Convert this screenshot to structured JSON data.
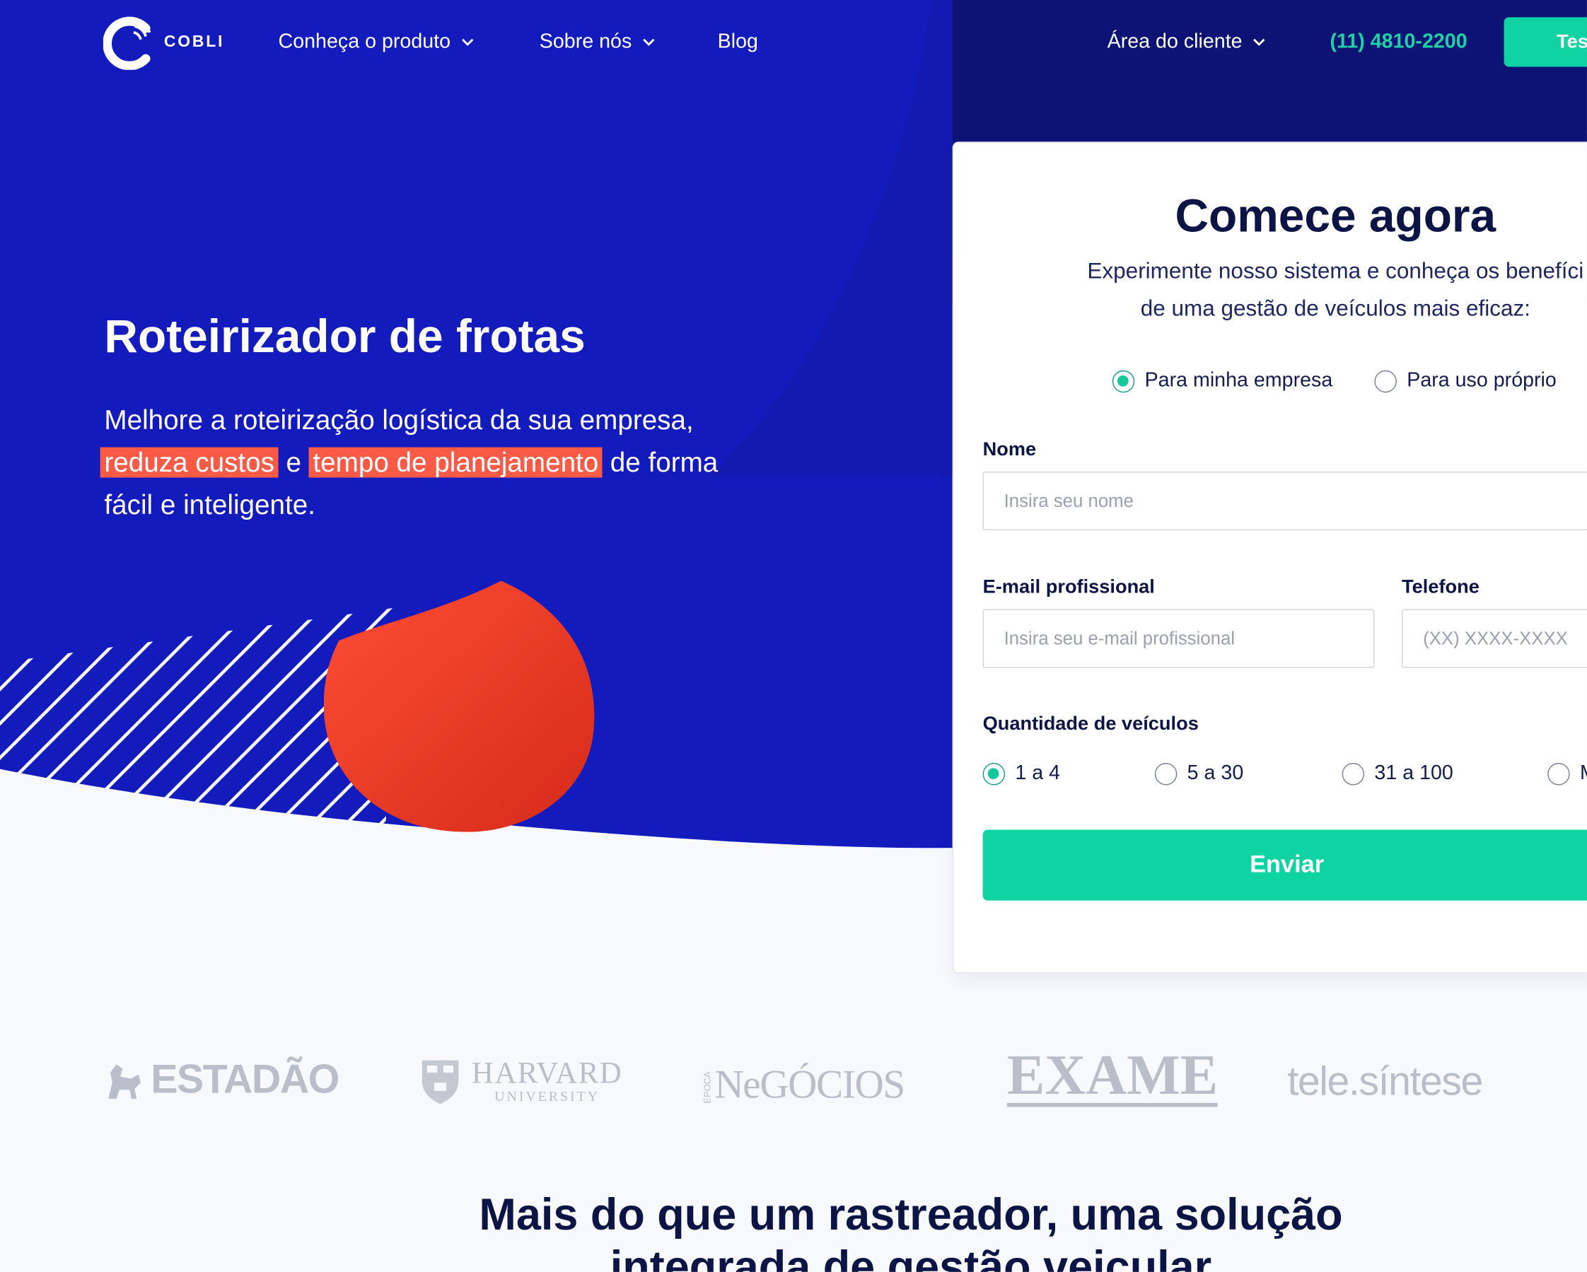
{
  "nav": {
    "brand": "COBLI",
    "product": "Conheça o produto",
    "about": "Sobre nós",
    "blog": "Blog",
    "client_area": "Área do cliente",
    "phone": "(11) 4810-2200",
    "cta": "Tes"
  },
  "hero": {
    "title": "Roteirizador de frotas",
    "line1": "Melhore a roteirização logística da sua empresa,",
    "hl1": "reduza custos",
    "and": "e",
    "hl2": "tempo de planejamento",
    "tail": "de forma",
    "line3": "fácil e inteligente."
  },
  "form": {
    "title": "Comece agora",
    "desc_line1": "Experimente nosso sistema e conheça os benefíci",
    "desc_line2": "de uma gestão de veículos mais eficaz:",
    "usage_options": [
      {
        "label": "Para minha empresa",
        "selected": true
      },
      {
        "label": "Para uso próprio",
        "selected": false
      }
    ],
    "name_label": "Nome",
    "name_placeholder": "Insira seu nome",
    "email_label": "E-mail profissional",
    "email_placeholder": "Insira seu e-mail profissional",
    "phone_label": "Telefone",
    "phone_placeholder": "(XX) XXXX-XXXX",
    "vehicles_label": "Quantidade de veículos",
    "vehicle_options": [
      {
        "label": "1 a 4",
        "selected": true
      },
      {
        "label": "5 a 30",
        "selected": false
      },
      {
        "label": "31 a 100",
        "selected": false
      },
      {
        "label": "M",
        "selected": false
      }
    ],
    "submit": "Enviar"
  },
  "press": {
    "estadao": "ESTADÃO",
    "harvard_1": "HARVARD",
    "harvard_2": "UNIVERSITY",
    "negocios": "NeGÓCIOS",
    "negocios_small": "ÉPOCA",
    "exame": "EXAME",
    "telesintese": "tele.síntese"
  },
  "section": {
    "title_line1": "Mais do que um rastreador, uma solução",
    "title_line2": "integrada de gestão veicular"
  },
  "colors": {
    "hero_blue": "#141bbd",
    "navy": "#0d1275",
    "accent_green": "#0fd3a3",
    "highlight_red": "#fb5a46"
  }
}
